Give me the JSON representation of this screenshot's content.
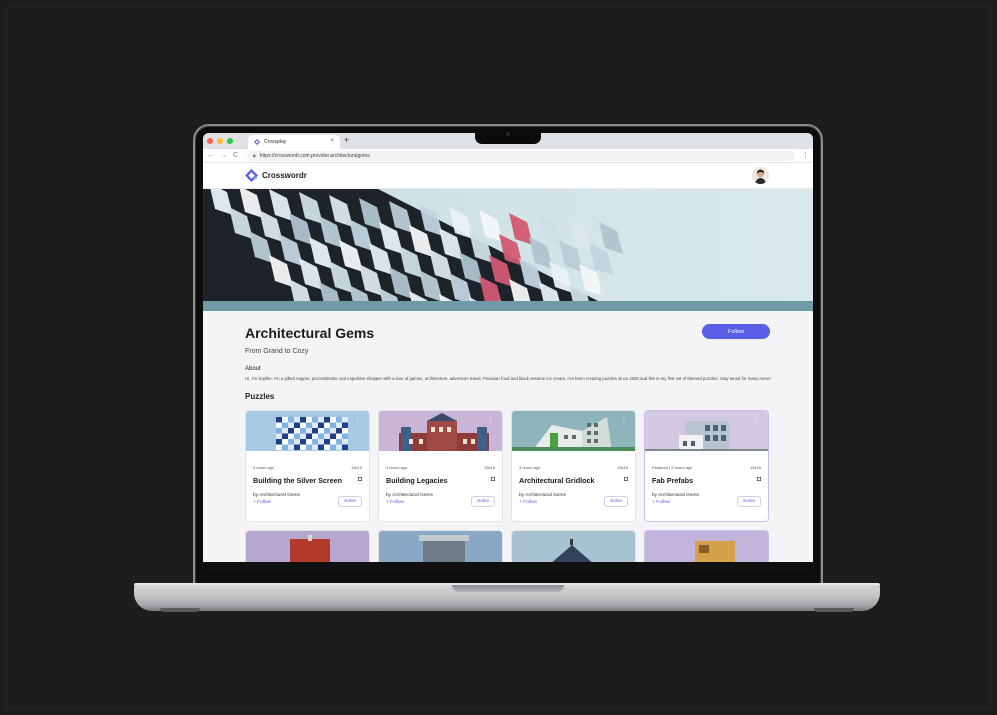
{
  "browser": {
    "tab_title": "Crossplay",
    "tab_close": "×",
    "new_tab": "+",
    "url": "https://crosswordr.com.provider.architecturalgems",
    "nav": {
      "back": "←",
      "forward": "→",
      "reload": "C"
    },
    "menu": "⋮"
  },
  "app": {
    "logo_text": "Crosswordr",
    "brand_color": "#5a5de6"
  },
  "profile": {
    "title": "Architectural Gems",
    "subtitle": "From Grand to Cozy",
    "follow_label": "Follow",
    "about_heading": "About",
    "about_text": "Hi, I'm Sophie. I'm a gifted napper, procrastinator and impulsive shopper with a love of games, architecture, adventure travel, Peruvian food and black sesame ice cream. I've been creating puzzles since 2020 and this is my first set of themed puzzles. Stay tuned for many more!",
    "puzzles_heading": "Puzzles"
  },
  "puzzles": [
    {
      "meta": "3 hours ago",
      "size": "15x15",
      "title": "Building the Silver Screen",
      "byline": "by Architectural Gems",
      "follow": "+ Follow",
      "solve": "Solve",
      "featured": false,
      "thumb": "checker"
    },
    {
      "meta": "3 hours ago",
      "size": "15x15",
      "title": "Building Legacies",
      "byline": "by Architectural Gems",
      "follow": "+ Follow",
      "solve": "Solve",
      "featured": false,
      "thumb": "palace"
    },
    {
      "meta": "3 hours ago",
      "size": "15x15",
      "title": "Architectural Gridlock",
      "byline": "by Architectural Gems",
      "follow": "+ Follow",
      "solve": "Solve",
      "featured": false,
      "thumb": "tower"
    },
    {
      "meta": "Featured | 3 hours ago",
      "size": "15x15",
      "title": "Fab Prefabs",
      "byline": "by Architectural Gems",
      "follow": "+ Follow",
      "solve": "Solve",
      "featured": true,
      "thumb": "prefab"
    }
  ],
  "icons": {
    "kebab": "⋮",
    "bookmark": "bookmark-icon",
    "lock": "lock-icon"
  }
}
